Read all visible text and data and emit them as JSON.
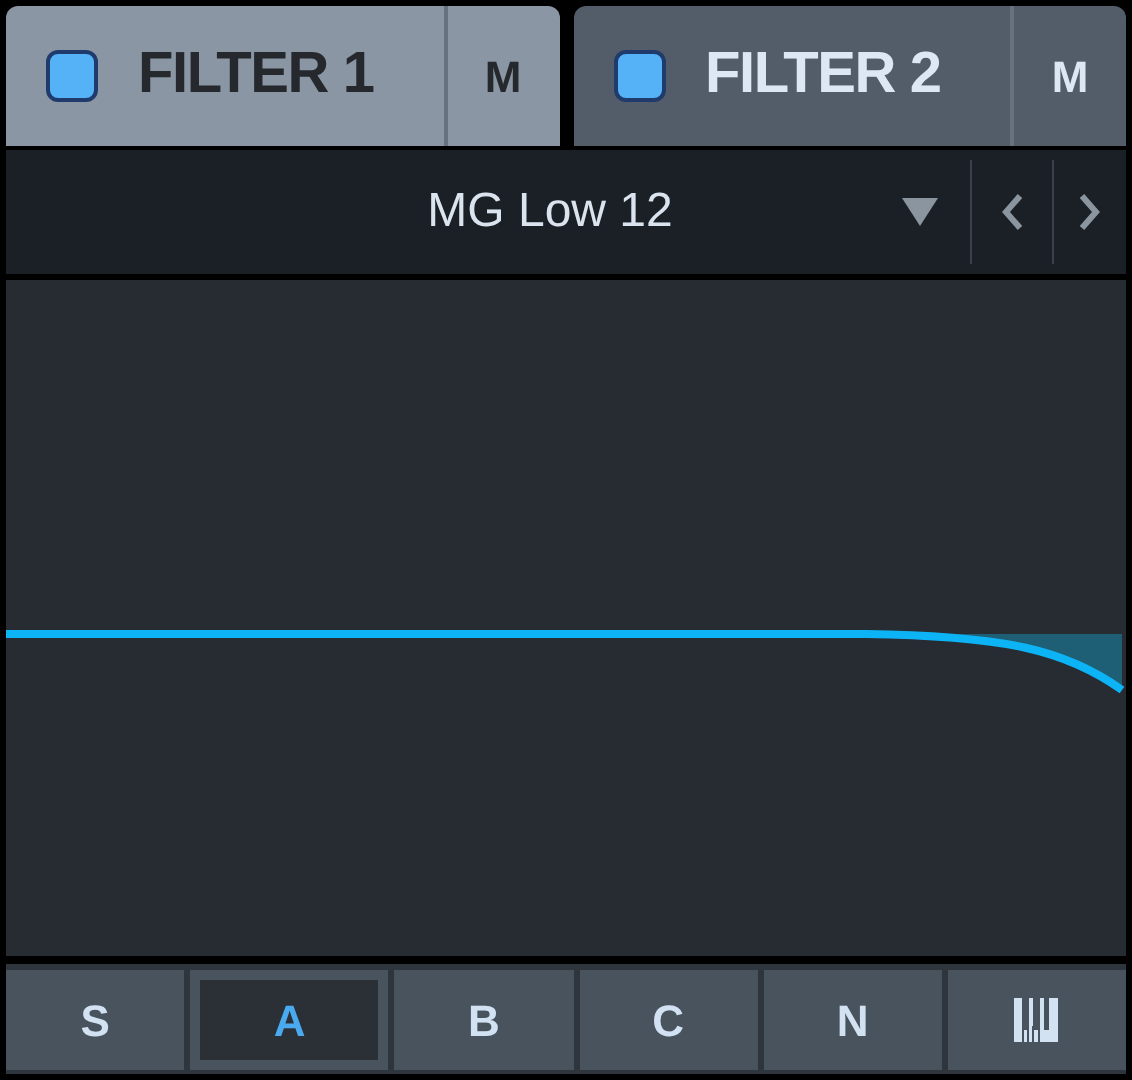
{
  "tabs": [
    {
      "label": "FILTER 1",
      "selected": true,
      "mute_label": "M"
    },
    {
      "label": "FILTER 2",
      "selected": false,
      "mute_label": "M"
    }
  ],
  "preset": {
    "name": "MG Low 12"
  },
  "modes": [
    {
      "kind": "text",
      "label": "S",
      "selected": false
    },
    {
      "kind": "text",
      "label": "A",
      "selected": true
    },
    {
      "kind": "text",
      "label": "B",
      "selected": false
    },
    {
      "kind": "text",
      "label": "C",
      "selected": false
    },
    {
      "kind": "text",
      "label": "N",
      "selected": false
    },
    {
      "kind": "keyboard",
      "selected": false
    }
  ]
}
